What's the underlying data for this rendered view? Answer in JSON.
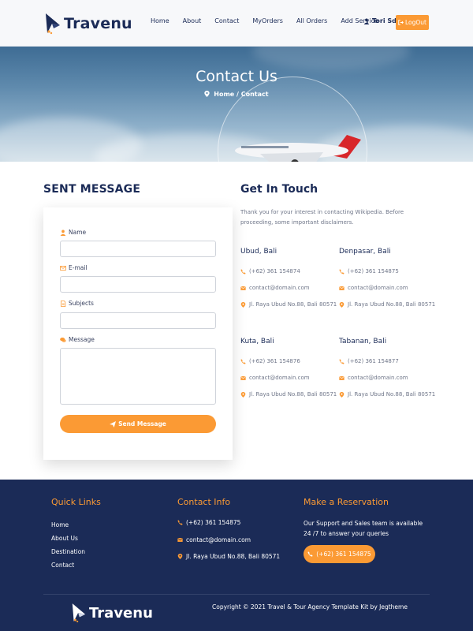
{
  "colors": {
    "accent": "#fb9a34",
    "navy": "#1b2b57",
    "text_muted": "#6f7689"
  },
  "header": {
    "logo_text": "Travenu",
    "nav": [
      "Home",
      "About",
      "Contact",
      "MyOrders",
      "All Orders",
      "Add Service"
    ],
    "user_name": "Tori Sd",
    "logout_label": "LogOut",
    "icons": {
      "user": "user-icon",
      "logout": "sign-out-icon"
    }
  },
  "hero": {
    "title": "Contact Us",
    "breadcrumb": "Home / Contact",
    "breadcrumb_icon": "map-marker-icon"
  },
  "form": {
    "title": "SENT MESSAGE",
    "fields": [
      {
        "label": "Name",
        "icon": "user-icon",
        "value": ""
      },
      {
        "label": "E-mail",
        "icon": "envelope-icon",
        "value": ""
      },
      {
        "label": "Subjects",
        "icon": "file-icon",
        "value": ""
      },
      {
        "label": "Message",
        "icon": "comments-icon",
        "value": ""
      }
    ],
    "submit_label": "Send Message",
    "submit_icon": "paper-plane-icon"
  },
  "touch": {
    "title": "Get In Touch",
    "intro": "Thank you for your interest in contacting Wikipedia. Before proceeding, some important disclaimers.",
    "locations": [
      {
        "name": "Ubud, Bali",
        "phone": "(+62) 361 154874",
        "email": "contact@domain.com",
        "address": "Jl. Raya Ubud No.88, Bali 80571"
      },
      {
        "name": "Denpasar, Bali",
        "phone": "(+62) 361 154875",
        "email": "contact@domain.com",
        "address": "Jl. Raya Ubud No.88, Bali 80571"
      },
      {
        "name": "Kuta, Bali",
        "phone": "(+62) 361 154876",
        "email": "contact@domain.com",
        "address": "Jl. Raya Ubud No.88, Bali 80571"
      },
      {
        "name": "Tabanan, Bali",
        "phone": "(+62) 361 154877",
        "email": "contact@domain.com",
        "address": "Jl. Raya Ubud No.88, Bali 80571"
      }
    ]
  },
  "footer": {
    "quick_links_title": "Quick Links",
    "quick_links": [
      "Home",
      "About Us",
      "Destination",
      "Contact"
    ],
    "contact_title": "Contact Info",
    "contact_phone": "(+62) 361 154875",
    "contact_email": "contact@domain.com",
    "contact_address": "Jl. Raya Ubud No.88, Bali 80571",
    "reservation_title": "Make a Reservation",
    "reservation_text": "Our Support and Sales team is available 24 /7 to answer your queries",
    "reservation_phone": "(+62) 361 154875",
    "logo_text": "Travenu",
    "copyright": "Copyright © 2021 Travel & Tour Agency Template Kit by Jegtheme"
  }
}
